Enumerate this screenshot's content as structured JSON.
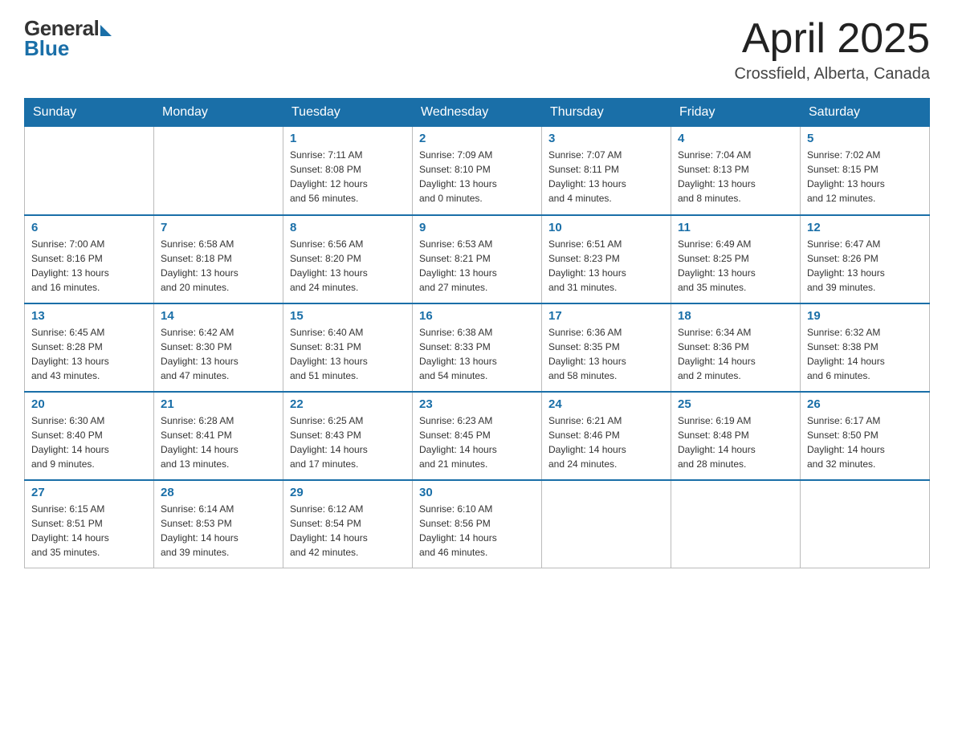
{
  "header": {
    "logo_general": "General",
    "logo_blue": "Blue",
    "month_title": "April 2025",
    "location": "Crossfield, Alberta, Canada"
  },
  "days_of_week": [
    "Sunday",
    "Monday",
    "Tuesday",
    "Wednesday",
    "Thursday",
    "Friday",
    "Saturday"
  ],
  "weeks": [
    [
      {
        "day": "",
        "info": ""
      },
      {
        "day": "",
        "info": ""
      },
      {
        "day": "1",
        "info": "Sunrise: 7:11 AM\nSunset: 8:08 PM\nDaylight: 12 hours\nand 56 minutes."
      },
      {
        "day": "2",
        "info": "Sunrise: 7:09 AM\nSunset: 8:10 PM\nDaylight: 13 hours\nand 0 minutes."
      },
      {
        "day": "3",
        "info": "Sunrise: 7:07 AM\nSunset: 8:11 PM\nDaylight: 13 hours\nand 4 minutes."
      },
      {
        "day": "4",
        "info": "Sunrise: 7:04 AM\nSunset: 8:13 PM\nDaylight: 13 hours\nand 8 minutes."
      },
      {
        "day": "5",
        "info": "Sunrise: 7:02 AM\nSunset: 8:15 PM\nDaylight: 13 hours\nand 12 minutes."
      }
    ],
    [
      {
        "day": "6",
        "info": "Sunrise: 7:00 AM\nSunset: 8:16 PM\nDaylight: 13 hours\nand 16 minutes."
      },
      {
        "day": "7",
        "info": "Sunrise: 6:58 AM\nSunset: 8:18 PM\nDaylight: 13 hours\nand 20 minutes."
      },
      {
        "day": "8",
        "info": "Sunrise: 6:56 AM\nSunset: 8:20 PM\nDaylight: 13 hours\nand 24 minutes."
      },
      {
        "day": "9",
        "info": "Sunrise: 6:53 AM\nSunset: 8:21 PM\nDaylight: 13 hours\nand 27 minutes."
      },
      {
        "day": "10",
        "info": "Sunrise: 6:51 AM\nSunset: 8:23 PM\nDaylight: 13 hours\nand 31 minutes."
      },
      {
        "day": "11",
        "info": "Sunrise: 6:49 AM\nSunset: 8:25 PM\nDaylight: 13 hours\nand 35 minutes."
      },
      {
        "day": "12",
        "info": "Sunrise: 6:47 AM\nSunset: 8:26 PM\nDaylight: 13 hours\nand 39 minutes."
      }
    ],
    [
      {
        "day": "13",
        "info": "Sunrise: 6:45 AM\nSunset: 8:28 PM\nDaylight: 13 hours\nand 43 minutes."
      },
      {
        "day": "14",
        "info": "Sunrise: 6:42 AM\nSunset: 8:30 PM\nDaylight: 13 hours\nand 47 minutes."
      },
      {
        "day": "15",
        "info": "Sunrise: 6:40 AM\nSunset: 8:31 PM\nDaylight: 13 hours\nand 51 minutes."
      },
      {
        "day": "16",
        "info": "Sunrise: 6:38 AM\nSunset: 8:33 PM\nDaylight: 13 hours\nand 54 minutes."
      },
      {
        "day": "17",
        "info": "Sunrise: 6:36 AM\nSunset: 8:35 PM\nDaylight: 13 hours\nand 58 minutes."
      },
      {
        "day": "18",
        "info": "Sunrise: 6:34 AM\nSunset: 8:36 PM\nDaylight: 14 hours\nand 2 minutes."
      },
      {
        "day": "19",
        "info": "Sunrise: 6:32 AM\nSunset: 8:38 PM\nDaylight: 14 hours\nand 6 minutes."
      }
    ],
    [
      {
        "day": "20",
        "info": "Sunrise: 6:30 AM\nSunset: 8:40 PM\nDaylight: 14 hours\nand 9 minutes."
      },
      {
        "day": "21",
        "info": "Sunrise: 6:28 AM\nSunset: 8:41 PM\nDaylight: 14 hours\nand 13 minutes."
      },
      {
        "day": "22",
        "info": "Sunrise: 6:25 AM\nSunset: 8:43 PM\nDaylight: 14 hours\nand 17 minutes."
      },
      {
        "day": "23",
        "info": "Sunrise: 6:23 AM\nSunset: 8:45 PM\nDaylight: 14 hours\nand 21 minutes."
      },
      {
        "day": "24",
        "info": "Sunrise: 6:21 AM\nSunset: 8:46 PM\nDaylight: 14 hours\nand 24 minutes."
      },
      {
        "day": "25",
        "info": "Sunrise: 6:19 AM\nSunset: 8:48 PM\nDaylight: 14 hours\nand 28 minutes."
      },
      {
        "day": "26",
        "info": "Sunrise: 6:17 AM\nSunset: 8:50 PM\nDaylight: 14 hours\nand 32 minutes."
      }
    ],
    [
      {
        "day": "27",
        "info": "Sunrise: 6:15 AM\nSunset: 8:51 PM\nDaylight: 14 hours\nand 35 minutes."
      },
      {
        "day": "28",
        "info": "Sunrise: 6:14 AM\nSunset: 8:53 PM\nDaylight: 14 hours\nand 39 minutes."
      },
      {
        "day": "29",
        "info": "Sunrise: 6:12 AM\nSunset: 8:54 PM\nDaylight: 14 hours\nand 42 minutes."
      },
      {
        "day": "30",
        "info": "Sunrise: 6:10 AM\nSunset: 8:56 PM\nDaylight: 14 hours\nand 46 minutes."
      },
      {
        "day": "",
        "info": ""
      },
      {
        "day": "",
        "info": ""
      },
      {
        "day": "",
        "info": ""
      }
    ]
  ]
}
